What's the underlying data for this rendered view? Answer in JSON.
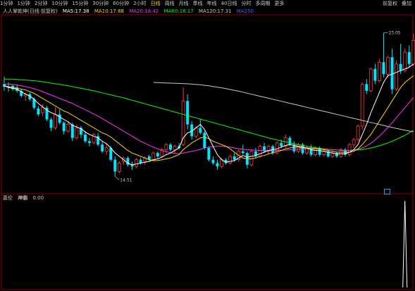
{
  "toolbar": {
    "items": [
      "1分钟",
      "1分钟",
      "2分钟",
      "10分钟",
      "15分钟",
      "30分钟",
      "60分钟",
      "2小时",
      "日线",
      "周线",
      "月线",
      "季线",
      "年线",
      "40日线",
      "分时",
      "多周期",
      "更多"
    ],
    "active_index": 8,
    "right": [
      "前复权",
      "叠加"
    ]
  },
  "legend": {
    "title": "人人掌乾坤(日线·前复权)",
    "ma5": "MA5:17.38",
    "ma10": "MA10:17.88",
    "ma20": "MA20:18.42",
    "ma60": "MA60:18.17",
    "ma120": "MA120:17.31",
    "ma250": "MA250:"
  },
  "legend2": {
    "name": "嘉伦",
    "label": "神霸",
    "value": "0.00"
  },
  "colors": {
    "up": "#ff3c3c",
    "down": "#00e5ff",
    "ma5": "#ffffff",
    "ma10": "#ffd400",
    "ma20": "#ff30ff",
    "ma60": "#00ff00",
    "ma120": "#c8c8c8",
    "indicator": "#ffffff",
    "frame": "#8b0000"
  },
  "chart_data": {
    "type": "candlestick",
    "ylim": [
      13.6,
      24.0
    ],
    "annotations": {
      "high": "23.05",
      "low": "14.51"
    },
    "candles": [
      [
        20.0,
        20.45,
        19.6,
        19.85
      ],
      [
        19.85,
        20.1,
        19.55,
        19.8
      ],
      [
        19.9,
        19.95,
        19.6,
        19.7
      ],
      [
        19.8,
        19.95,
        19.5,
        19.6
      ],
      [
        19.6,
        19.7,
        19.2,
        19.3
      ],
      [
        19.3,
        19.5,
        19.0,
        19.4
      ],
      [
        19.4,
        19.5,
        19.0,
        19.1
      ],
      [
        19.1,
        19.2,
        18.5,
        18.6
      ],
      [
        18.55,
        18.7,
        18.1,
        18.2
      ],
      [
        18.3,
        18.8,
        18.1,
        18.6
      ],
      [
        18.6,
        18.7,
        17.8,
        17.9
      ],
      [
        17.9,
        18.0,
        17.2,
        17.4
      ],
      [
        17.4,
        18.6,
        17.3,
        18.2
      ],
      [
        18.2,
        18.5,
        17.6,
        17.7
      ],
      [
        17.7,
        17.8,
        17.0,
        17.2
      ],
      [
        17.2,
        17.8,
        17.1,
        17.6
      ],
      [
        17.6,
        17.7,
        16.6,
        16.8
      ],
      [
        16.8,
        17.6,
        16.7,
        17.4
      ],
      [
        17.4,
        17.5,
        16.8,
        17.0
      ],
      [
        17.0,
        17.2,
        16.5,
        16.6
      ],
      [
        16.6,
        16.8,
        16.3,
        16.5
      ],
      [
        16.5,
        17.1,
        16.4,
        17.0
      ],
      [
        16.9,
        17.1,
        16.3,
        16.4
      ],
      [
        16.4,
        16.6,
        15.9,
        16.0
      ],
      [
        16.0,
        16.5,
        15.8,
        16.2
      ],
      [
        16.2,
        16.3,
        15.4,
        15.5
      ],
      [
        15.5,
        15.7,
        14.51,
        14.8
      ],
      [
        14.8,
        15.4,
        14.7,
        15.3
      ],
      [
        15.4,
        15.7,
        15.2,
        15.6
      ],
      [
        15.6,
        15.7,
        15.1,
        15.2
      ],
      [
        15.2,
        15.4,
        14.9,
        15.1
      ],
      [
        15.1,
        15.6,
        15.0,
        15.5
      ],
      [
        15.5,
        15.6,
        15.2,
        15.3
      ],
      [
        15.4,
        15.7,
        15.2,
        15.6
      ],
      [
        15.7,
        15.8,
        15.4,
        15.5
      ],
      [
        15.5,
        16.0,
        15.4,
        15.9
      ],
      [
        15.9,
        16.0,
        15.6,
        15.7
      ],
      [
        15.7,
        16.2,
        15.6,
        16.1
      ],
      [
        16.1,
        16.5,
        15.9,
        16.4
      ],
      [
        16.4,
        16.5,
        16.0,
        16.1
      ],
      [
        16.1,
        16.4,
        15.9,
        16.3
      ],
      [
        16.3,
        16.5,
        16.1,
        16.2
      ],
      [
        16.4,
        19.8,
        16.3,
        19.0
      ],
      [
        19.0,
        19.4,
        17.3,
        17.6
      ],
      [
        17.6,
        17.8,
        16.7,
        16.9
      ],
      [
        16.9,
        17.5,
        16.8,
        17.4
      ],
      [
        17.4,
        17.9,
        17.0,
        17.1
      ],
      [
        17.1,
        17.2,
        16.1,
        16.2
      ],
      [
        16.2,
        16.3,
        15.4,
        15.5
      ],
      [
        15.5,
        15.7,
        15.2,
        15.3
      ],
      [
        15.3,
        15.5,
        14.9,
        15.1
      ],
      [
        15.1,
        15.6,
        15.0,
        15.5
      ],
      [
        15.5,
        15.6,
        15.2,
        15.3
      ],
      [
        15.3,
        15.8,
        15.2,
        15.7
      ],
      [
        15.7,
        15.9,
        15.4,
        15.5
      ],
      [
        15.5,
        16.1,
        15.4,
        16.0
      ],
      [
        16.0,
        16.4,
        15.8,
        15.9
      ],
      [
        15.9,
        16.0,
        15.0,
        15.2
      ],
      [
        15.2,
        16.1,
        15.1,
        16.0
      ],
      [
        16.0,
        16.2,
        15.6,
        15.7
      ],
      [
        15.7,
        16.4,
        15.6,
        16.3
      ],
      [
        16.3,
        16.5,
        15.9,
        16.0
      ],
      [
        16.0,
        16.4,
        15.8,
        16.3
      ],
      [
        16.3,
        16.4,
        15.8,
        15.9
      ],
      [
        15.9,
        16.6,
        15.8,
        16.5
      ],
      [
        16.5,
        16.7,
        16.2,
        16.3
      ],
      [
        16.3,
        17.0,
        16.2,
        16.8
      ],
      [
        16.8,
        16.9,
        16.3,
        16.4
      ],
      [
        16.4,
        16.6,
        15.9,
        16.0
      ],
      [
        16.0,
        16.5,
        15.9,
        16.4
      ],
      [
        16.4,
        16.5,
        15.8,
        15.9
      ],
      [
        15.9,
        16.3,
        15.8,
        16.2
      ],
      [
        16.2,
        16.4,
        15.7,
        15.8
      ],
      [
        15.8,
        16.3,
        15.7,
        16.2
      ],
      [
        16.2,
        16.3,
        15.7,
        15.8
      ],
      [
        15.8,
        16.1,
        15.7,
        16.0
      ],
      [
        16.0,
        16.1,
        15.6,
        15.7
      ],
      [
        15.7,
        16.0,
        15.6,
        15.9
      ],
      [
        15.9,
        16.0,
        15.6,
        15.7
      ],
      [
        15.7,
        16.2,
        15.6,
        16.1
      ],
      [
        16.1,
        16.2,
        15.7,
        15.8
      ],
      [
        15.8,
        16.5,
        15.7,
        16.4
      ],
      [
        16.4,
        16.8,
        16.2,
        16.7
      ],
      [
        16.7,
        17.6,
        16.6,
        17.5
      ],
      [
        17.5,
        20.1,
        17.3,
        20.0
      ],
      [
        20.0,
        20.3,
        19.4,
        19.6
      ],
      [
        19.6,
        21.0,
        19.5,
        20.9
      ],
      [
        20.9,
        21.2,
        20.0,
        20.2
      ],
      [
        20.2,
        21.5,
        20.1,
        21.3
      ],
      [
        21.3,
        23.05,
        20.4,
        20.6
      ],
      [
        20.6,
        21.7,
        20.4,
        21.6
      ],
      [
        21.6,
        22.1,
        19.4,
        19.7
      ],
      [
        19.7,
        21.4,
        19.6,
        21.2
      ],
      [
        21.2,
        22.4,
        20.6,
        20.8
      ],
      [
        20.8,
        22.1,
        20.7,
        21.9
      ],
      [
        21.9,
        22.3,
        21.0,
        21.2
      ],
      [
        21.2,
        23.0,
        21.1,
        22.6
      ]
    ],
    "ma5": [
      19.9,
      19.8,
      19.75,
      19.7,
      19.55,
      19.4,
      19.3,
      19.1,
      18.85,
      18.65,
      18.45,
      18.3,
      18.2,
      18.05,
      17.9,
      17.75,
      17.55,
      17.45,
      17.35,
      17.15,
      17.0,
      16.9,
      16.8,
      16.6,
      16.45,
      16.2,
      15.9,
      15.7,
      15.5,
      15.3,
      15.2,
      15.25,
      15.3,
      15.35,
      15.4,
      15.5,
      15.55,
      15.65,
      15.8,
      15.9,
      16.05,
      16.2,
      16.8,
      17.1,
      17.2,
      17.4,
      17.6,
      17.3,
      16.8,
      16.3,
      15.8,
      15.5,
      15.35,
      15.4,
      15.45,
      15.6,
      15.75,
      15.65,
      15.7,
      15.75,
      15.85,
      15.95,
      16.05,
      16.1,
      16.15,
      16.25,
      16.35,
      16.4,
      16.35,
      16.3,
      16.25,
      16.2,
      16.1,
      16.05,
      16.05,
      16.0,
      15.95,
      15.9,
      15.85,
      15.85,
      15.85,
      15.95,
      16.1,
      16.4,
      17.0,
      17.6,
      18.3,
      18.9,
      19.5,
      20.1,
      20.5,
      20.6,
      20.7,
      20.8,
      20.9,
      21.0,
      21.2
    ],
    "ma10": [
      19.9,
      19.85,
      19.8,
      19.75,
      19.7,
      19.65,
      19.55,
      19.45,
      19.3,
      19.15,
      19.0,
      18.85,
      18.7,
      18.55,
      18.4,
      18.3,
      18.15,
      18.0,
      17.85,
      17.7,
      17.55,
      17.4,
      17.25,
      17.1,
      17.0,
      16.85,
      16.65,
      16.45,
      16.25,
      16.05,
      15.9,
      15.8,
      15.7,
      15.6,
      15.5,
      15.45,
      15.45,
      15.5,
      15.55,
      15.6,
      15.7,
      15.8,
      16.1,
      16.3,
      16.5,
      16.65,
      16.8,
      16.85,
      16.75,
      16.6,
      16.5,
      16.4,
      16.3,
      16.15,
      15.95,
      15.75,
      15.6,
      15.55,
      15.55,
      15.6,
      15.7,
      15.75,
      15.85,
      15.9,
      16.0,
      16.05,
      16.15,
      16.2,
      16.25,
      16.25,
      16.2,
      16.2,
      16.2,
      16.15,
      16.15,
      16.1,
      16.05,
      16.0,
      15.95,
      15.95,
      15.95,
      15.95,
      16.0,
      16.15,
      16.4,
      16.7,
      17.0,
      17.4,
      17.8,
      18.2,
      18.6,
      19.0,
      19.4,
      19.8,
      20.1,
      20.3,
      20.5
    ],
    "ma20": [
      20.0,
      20.0,
      19.98,
      19.95,
      19.9,
      19.85,
      19.8,
      19.72,
      19.65,
      19.55,
      19.45,
      19.35,
      19.25,
      19.15,
      19.05,
      18.95,
      18.85,
      18.72,
      18.6,
      18.48,
      18.35,
      18.22,
      18.1,
      17.95,
      17.8,
      17.65,
      17.5,
      17.35,
      17.2,
      17.05,
      16.9,
      16.75,
      16.6,
      16.48,
      16.36,
      16.25,
      16.15,
      16.05,
      15.98,
      15.92,
      15.88,
      15.86,
      15.9,
      15.95,
      16.0,
      16.05,
      16.12,
      16.2,
      16.25,
      16.28,
      16.3,
      16.3,
      16.28,
      16.25,
      16.2,
      16.15,
      16.12,
      16.1,
      16.08,
      16.06,
      16.05,
      16.05,
      16.05,
      16.05,
      16.06,
      16.07,
      16.08,
      16.1,
      16.12,
      16.13,
      16.14,
      16.15,
      16.15,
      16.15,
      16.14,
      16.13,
      16.12,
      16.1,
      16.08,
      16.06,
      16.05,
      16.05,
      16.08,
      16.12,
      16.2,
      16.32,
      16.48,
      16.68,
      16.9,
      17.15,
      17.42,
      17.7,
      18.0,
      18.3,
      18.6,
      18.9,
      19.2
    ],
    "ma60": [
      20.3,
      20.3,
      20.3,
      20.28,
      20.26,
      20.24,
      20.22,
      20.2,
      20.17,
      20.14,
      20.1,
      20.06,
      20.02,
      19.98,
      19.94,
      19.9,
      19.85,
      19.8,
      19.75,
      19.7,
      19.65,
      19.6,
      19.54,
      19.48,
      19.42,
      19.36,
      19.3,
      19.24,
      19.18,
      19.11,
      19.04,
      18.97,
      18.9,
      18.83,
      18.76,
      18.69,
      18.62,
      18.55,
      18.48,
      18.41,
      18.34,
      18.27,
      18.2,
      18.13,
      18.06,
      17.99,
      17.92,
      17.85,
      17.78,
      17.71,
      17.64,
      17.57,
      17.5,
      17.43,
      17.36,
      17.29,
      17.22,
      17.15,
      17.08,
      17.01,
      16.94,
      16.87,
      16.8,
      16.74,
      16.68,
      16.62,
      16.56,
      16.5,
      16.45,
      16.4,
      16.35,
      16.3,
      16.26,
      16.22,
      16.18,
      16.15,
      16.12,
      16.1,
      16.08,
      16.06,
      16.05,
      16.05,
      16.06,
      16.08,
      16.11,
      16.15,
      16.2,
      16.26,
      16.33,
      16.41,
      16.5,
      16.6,
      16.71,
      16.83,
      16.96,
      17.1,
      17.25
    ],
    "ma120_start": 35,
    "ma120": [
      20.1,
      20.09,
      20.08,
      20.07,
      20.06,
      20.05,
      20.04,
      20.03,
      20.02,
      20.0,
      19.98,
      19.96,
      19.93,
      19.9,
      19.86,
      19.82,
      19.78,
      19.73,
      19.68,
      19.63,
      19.58,
      19.52,
      19.46,
      19.4,
      19.34,
      19.28,
      19.22,
      19.16,
      19.1,
      19.04,
      18.98,
      18.92,
      18.86,
      18.8,
      18.74,
      18.68,
      18.62,
      18.56,
      18.5,
      18.44,
      18.38,
      18.32,
      18.26,
      18.2,
      18.14,
      18.08,
      18.02,
      17.96,
      17.9,
      17.84,
      17.78,
      17.72,
      17.66,
      17.6,
      17.54,
      17.48,
      17.42,
      17.36,
      17.31,
      17.26,
      17.21,
      17.16
    ],
    "indicator": {
      "ylim": [
        0,
        1
      ],
      "spike_index": 94,
      "values_nonzero": {
        "94": 1.0
      }
    }
  }
}
